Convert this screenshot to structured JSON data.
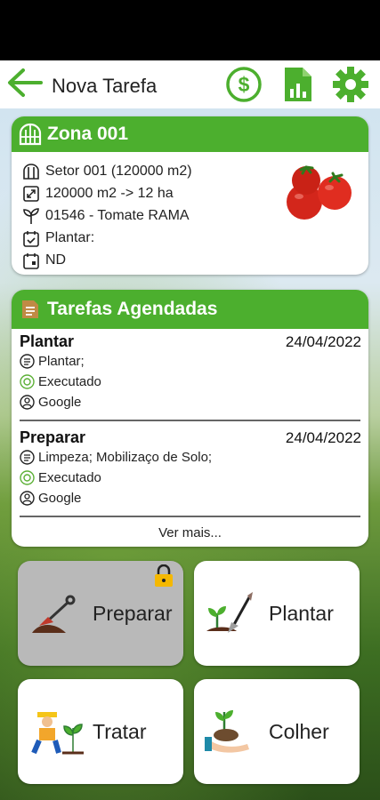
{
  "header": {
    "title": "Nova Tarefa",
    "back_icon": "arrow-left-icon",
    "actions": [
      "dollar-icon",
      "report-icon",
      "gear-icon"
    ],
    "accent": "#4caf2e"
  },
  "zone": {
    "title": "Zona 001",
    "sector": "Setor 001 (120000 m2)",
    "area": "120000 m2 -> 12 ha",
    "crop": "01546 - Tomate RAMA",
    "activity": "Plantar:",
    "status": "ND"
  },
  "scheduled": {
    "title": "Tarefas Agendadas",
    "tasks": [
      {
        "name": "Plantar",
        "date": "24/04/2022",
        "detail": "Plantar;",
        "status": "Executado",
        "user": "Google"
      },
      {
        "name": "Preparar",
        "date": "24/04/2022",
        "detail": "Limpeza; Mobilizaço de Solo;",
        "status": "Executado",
        "user": "Google"
      }
    ],
    "more": "Ver mais..."
  },
  "actions": {
    "preparar": "Preparar",
    "plantar": "Plantar",
    "tratar": "Tratar",
    "colher": "Colher"
  }
}
